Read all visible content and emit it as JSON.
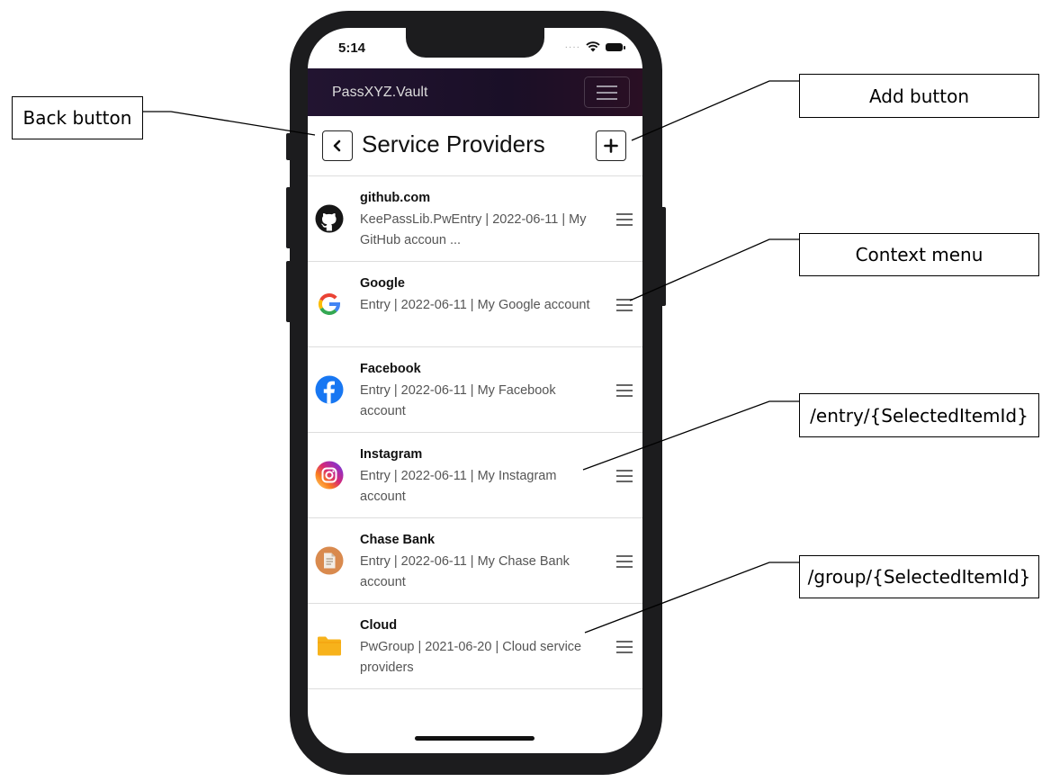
{
  "status": {
    "time": "5:14"
  },
  "navbar": {
    "brand": "PassXYZ.Vault",
    "toggler_icon": "hamburger-icon"
  },
  "header": {
    "title": "Service Providers",
    "back_icon": "chevron-left-icon",
    "add_icon": "plus-icon"
  },
  "items": [
    {
      "name": "github.com",
      "desc": "KeePassLib.PwEntry | 2022-06-11 | My GitHub accoun ...",
      "icon": "github-icon"
    },
    {
      "name": "Google",
      "desc": "Entry | 2022-06-11 | My Google account",
      "icon": "google-icon"
    },
    {
      "name": "Facebook",
      "desc": "Entry | 2022-06-11 | My Facebook account",
      "icon": "facebook-icon"
    },
    {
      "name": "Instagram",
      "desc": "Entry | 2022-06-11 | My Instagram account",
      "icon": "instagram-icon"
    },
    {
      "name": "Chase Bank",
      "desc": "Entry | 2022-06-11 | My Chase Bank account",
      "icon": "document-icon"
    },
    {
      "name": "Cloud",
      "desc": "PwGroup | 2021-06-20 | Cloud service providers",
      "icon": "folder-icon"
    }
  ],
  "callouts": {
    "back": "Back button",
    "add": "Add button",
    "context": "Context menu",
    "entry": "/entry/{SelectedItemId}",
    "group": "/group/{SelectedItemId}"
  },
  "colors": {
    "navbar": "#1f1230",
    "facebook": "#1877f2",
    "folder": "#f7b21b",
    "chase_icon": "#d98a4e"
  }
}
